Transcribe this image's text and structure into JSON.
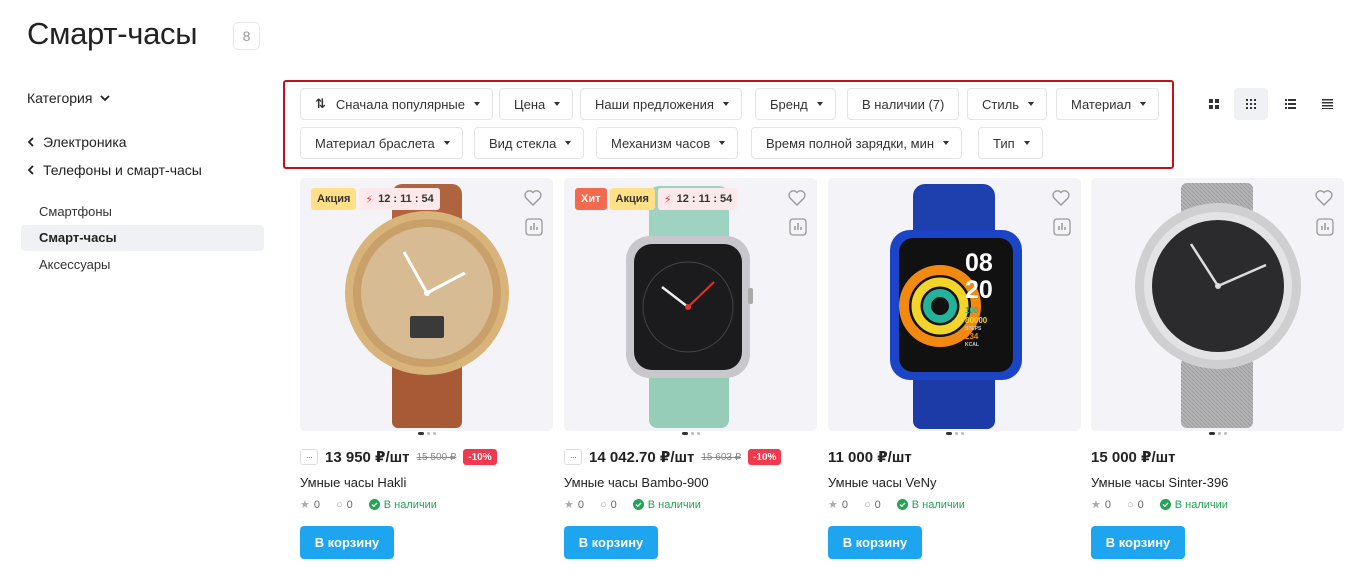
{
  "page": {
    "title": "Смарт-часы",
    "count": "8"
  },
  "sidebar": {
    "category_label": "Категория",
    "crumbs": [
      "Электроника",
      "Телефоны и смарт-часы"
    ],
    "items": [
      {
        "label": "Смартфоны",
        "active": false
      },
      {
        "label": "Смарт-часы",
        "active": true
      },
      {
        "label": "Аксессуары",
        "active": false
      }
    ]
  },
  "filters": {
    "row1": [
      "Сначала популярные",
      "Цена",
      "Наши предложения",
      "Бренд",
      "В наличии (7)",
      "Стиль",
      "Материал"
    ],
    "row2": [
      "Материал браслета",
      "Вид стекла",
      "Механизм часов",
      "Время полной зарядки, мин",
      "Тип"
    ]
  },
  "view_modes": [
    "tiles-large-icon",
    "tiles-small-icon",
    "list-icon",
    "table-icon"
  ],
  "products": [
    {
      "name": "Умные часы Hakli",
      "price": "13 950 ₽/шт",
      "old_price": "15 500 ₽",
      "discount": "-10%",
      "badges": [
        "Акция"
      ],
      "timer": "12 : 11 : 54",
      "rating": "0",
      "reviews": "0",
      "stock": "В наличии",
      "button": "В корзину",
      "image": "gold-analog-watch"
    },
    {
      "name": "Умные часы Bambo-900",
      "price": "14 042.70 ₽/шт",
      "old_price": "15 603 ₽",
      "discount": "-10%",
      "badges": [
        "Хит",
        "Акция"
      ],
      "timer": "12 : 11 : 54",
      "rating": "0",
      "reviews": "0",
      "stock": "В наличии",
      "button": "В корзину",
      "image": "square-smartwatch-mint"
    },
    {
      "name": "Умные часы VeNy",
      "price": "11 000 ₽/шт",
      "old_price": "",
      "discount": "",
      "badges": [],
      "timer": "",
      "rating": "0",
      "reviews": "0",
      "stock": "В наличии",
      "button": "В корзину",
      "image": "blue-fitness-watch",
      "screen": {
        "time_h": "08",
        "time_m": "20",
        "stat1": "100",
        "stat2": "80000",
        "stat2_label": "STEPS",
        "stat3": "234",
        "stat3_label": "KCAL"
      }
    },
    {
      "name": "Умные часы Sinter-396",
      "price": "15 000 ₽/шт",
      "old_price": "",
      "discount": "",
      "badges": [],
      "timer": "",
      "rating": "0",
      "reviews": "0",
      "stock": "В наличии",
      "button": "В корзину",
      "image": "silver-mesh-watch"
    }
  ],
  "colors": {
    "accent": "#1ea5ef",
    "discount": "#f0384e",
    "highlight_border": "#c0121c",
    "stock": "#23a355"
  }
}
